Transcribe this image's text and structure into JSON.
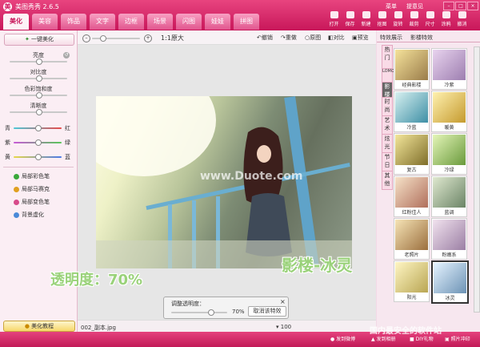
{
  "app": {
    "title": "美图秀秀 2.6.5"
  },
  "tabs": [
    "美化",
    "美容",
    "饰品",
    "文字",
    "边框",
    "场景",
    "闪图",
    "娃娃",
    "拼图"
  ],
  "menu": {
    "links": [
      "菜单",
      "提意见"
    ]
  },
  "toolbar": [
    "打开",
    "保存",
    "新建",
    "抠图",
    "旋转",
    "裁剪",
    "尺寸",
    "涂鸦",
    "撤消"
  ],
  "left": {
    "one_click": "一键美化",
    "sliders": [
      "亮度",
      "对比度",
      "色彩饱和度",
      "清晰度"
    ],
    "color_rows": [
      [
        "青",
        "红"
      ],
      [
        "紫",
        "绿"
      ],
      [
        "黄",
        "蓝"
      ]
    ],
    "effects": [
      "局部彩色笔",
      "局部马赛克",
      "局部变色笔",
      "背景虚化"
    ],
    "tutorial": "美化教程"
  },
  "center": {
    "zoom_label": "1:1原大",
    "actions": [
      "撤销",
      "重做",
      "原图",
      "对比",
      "预览"
    ],
    "filename": "002_副本.jpg",
    "watermark": "www.Duote.com"
  },
  "dialog": {
    "title": "调整透明度：",
    "value": "70%",
    "cancel": "取消该特效",
    "close": "×"
  },
  "annotations": {
    "left": "透明度：70%",
    "right": "影楼-冰灵"
  },
  "right": {
    "header_tabs": [
      "特效展示",
      "影楼特效"
    ],
    "vtabs": [
      "热门",
      "LOMO",
      "影楼",
      "时尚",
      "艺术",
      "炫光",
      "节日",
      "其他"
    ],
    "thumbs": [
      {
        "label": "经典影楼",
        "c1": "#f5e29a",
        "c2": "#9a7c4a"
      },
      {
        "label": "冷紫",
        "c1": "#e8d3ee",
        "c2": "#9d7eb0"
      },
      {
        "label": "冷蓝",
        "c1": "#d7f0f0",
        "c2": "#3e8fa5"
      },
      {
        "label": "暖黄",
        "c1": "#fff1b0",
        "c2": "#c59a2e"
      },
      {
        "label": "复古",
        "c1": "#f3e69a",
        "c2": "#7f6e2a"
      },
      {
        "label": "冷绿",
        "c1": "#e4f5b8",
        "c2": "#6a9a3c"
      },
      {
        "label": "红粉佳人",
        "c1": "#f6e2c8",
        "c2": "#b06f5c"
      },
      {
        "label": "蓝调",
        "c1": "#dfe8cf",
        "c2": "#6b8466"
      },
      {
        "label": "老照片",
        "c1": "#f6e4b6",
        "c2": "#9b6f3e"
      },
      {
        "label": "粉嫩系",
        "c1": "#f1e2ee",
        "c2": "#9b7fa4"
      },
      {
        "label": "阳光",
        "c1": "#fff6c4",
        "c2": "#b9a653"
      },
      {
        "label": "冰灵",
        "c1": "#e5f3ff",
        "c2": "#6d93b5"
      }
    ]
  },
  "bottom": {
    "items": [
      "发到微博",
      "发到相册",
      "DIY礼物",
      "照片冲印"
    ],
    "site_watermark": "国内最安全的软件站",
    "zoom_value": "100"
  }
}
